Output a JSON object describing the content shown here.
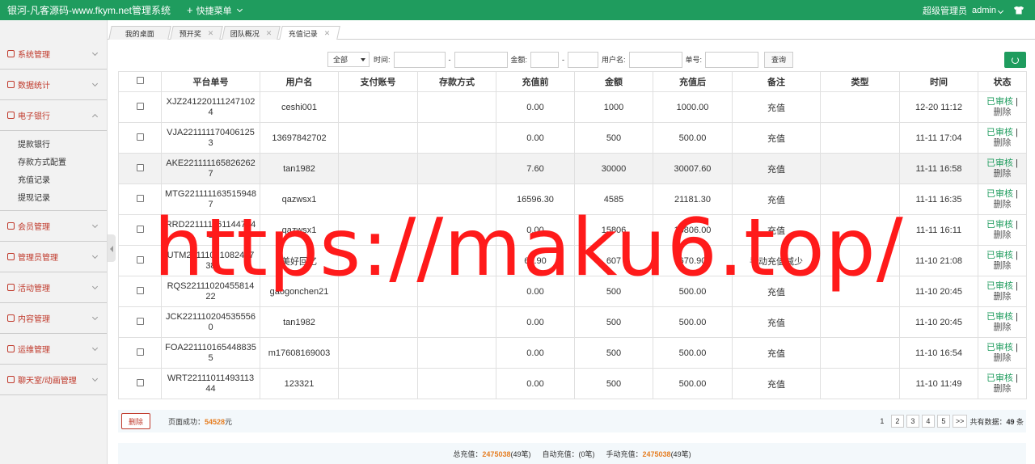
{
  "header": {
    "brand": "银河-凡客源码-www.fkym.net管理系统",
    "quick_menu": "快捷菜单",
    "role": "超级管理员",
    "user": "admin",
    "icons": [
      "plus-icon",
      "chevron-down-icon",
      "shirt-icon"
    ],
    "bg_color": "#1f9c5e"
  },
  "sidebar": {
    "items": [
      {
        "label": "系统管理",
        "expanded": false
      },
      {
        "label": "数据统计",
        "expanded": false
      },
      {
        "label": "电子银行",
        "expanded": true
      },
      {
        "label": "会员管理",
        "expanded": false
      },
      {
        "label": "管理员管理",
        "expanded": false
      },
      {
        "label": "活动管理",
        "expanded": false
      },
      {
        "label": "内容管理",
        "expanded": false
      },
      {
        "label": "运维管理",
        "expanded": false
      },
      {
        "label": "聊天室/动画管理",
        "expanded": false
      }
    ],
    "sub_items": [
      "提款银行",
      "存款方式配置",
      "充值记录",
      "提现记录"
    ]
  },
  "tabs": [
    {
      "label": "我的桌面",
      "closable": false
    },
    {
      "label": "预开奖",
      "closable": true
    },
    {
      "label": "团队概况",
      "closable": true
    },
    {
      "label": "充值记录",
      "closable": true,
      "active": true
    }
  ],
  "filters": {
    "select_value": "全部",
    "time_label": "时间:",
    "amount_label": "金额:",
    "username_label": "用户名:",
    "order_label": "单号:",
    "separator": "-",
    "query_button": "查询"
  },
  "table": {
    "headers": [
      "平台单号",
      "用户名",
      "支付账号",
      "存款方式",
      "充值前",
      "金额",
      "充值后",
      "备注",
      "类型",
      "时间",
      "状态"
    ],
    "rows": [
      {
        "order": "XJZ2412201112471024",
        "user": "ceshi001",
        "account": "",
        "method": "",
        "before": "0.00",
        "amount": "1000",
        "after": "1000.00",
        "note": "充值",
        "type": "",
        "time": "12-20 11:12",
        "status": "已审核",
        "action": "删除"
      },
      {
        "order": "VJA2211111704061253",
        "user": "13697842702",
        "account": "",
        "method": "",
        "before": "0.00",
        "amount": "500",
        "after": "500.00",
        "note": "充值",
        "type": "",
        "time": "11-11 17:04",
        "status": "已审核",
        "action": "删除"
      },
      {
        "order": "AKE2211111658262627",
        "user": "tan1982",
        "account": "",
        "method": "",
        "before": "7.60",
        "amount": "30000",
        "after": "30007.60",
        "note": "充值",
        "type": "",
        "time": "11-11 16:58",
        "status": "已审核",
        "action": "删除"
      },
      {
        "order": "MTG2211111635159487",
        "user": "qazwsx1",
        "account": "",
        "method": "",
        "before": "16596.30",
        "amount": "4585",
        "after": "21181.30",
        "note": "充值",
        "type": "",
        "time": "11-11 16:35",
        "status": "已审核",
        "action": "删除"
      },
      {
        "order": "RRD2211111611447541",
        "user": "qazwsx1",
        "account": "",
        "method": "",
        "before": "0.00",
        "amount": "15806",
        "after": "15806.00",
        "note": "充值",
        "type": "",
        "time": "11-11 16:11",
        "status": "已审核",
        "action": "删除"
      },
      {
        "order": "UTM2211102108241738",
        "user": "美好回忆",
        "account": "",
        "method": "",
        "before": "63.90",
        "amount": "607",
        "after": "670.90",
        "note": "手动充值减少",
        "type": "",
        "time": "11-10 21:08",
        "status": "已审核",
        "action": "删除"
      },
      {
        "order": "RQS2211102045581422",
        "user": "gaogonchen21",
        "account": "",
        "method": "",
        "before": "0.00",
        "amount": "500",
        "after": "500.00",
        "note": "充值",
        "type": "",
        "time": "11-10 20:45",
        "status": "已审核",
        "action": "删除"
      },
      {
        "order": "JCK2211102045355560",
        "user": "tan1982",
        "account": "",
        "method": "",
        "before": "0.00",
        "amount": "500",
        "after": "500.00",
        "note": "充值",
        "type": "",
        "time": "11-10 20:45",
        "status": "已审核",
        "action": "删除"
      },
      {
        "order": "FOA2211101654488355",
        "user": "m17608169003",
        "account": "",
        "method": "",
        "before": "0.00",
        "amount": "500",
        "after": "500.00",
        "note": "充值",
        "type": "",
        "time": "11-10 16:54",
        "status": "已审核",
        "action": "删除"
      },
      {
        "order": "WRT2211101149311344",
        "user": "123321",
        "account": "",
        "method": "",
        "before": "0.00",
        "amount": "500",
        "after": "500.00",
        "note": "充值",
        "type": "",
        "time": "11-10 11:49",
        "status": "已审核",
        "action": "删除"
      }
    ]
  },
  "footer": {
    "delete_button": "删除",
    "page_success_label": "页面成功：",
    "page_success_value": "54528",
    "page_success_unit": "元",
    "pages": [
      "1",
      "2",
      "3",
      "4",
      "5",
      ">>"
    ],
    "total_label": "共有数据：",
    "total_value": "49",
    "total_unit": "条",
    "sum_total_label": "总充值：",
    "sum_total_value": "2475038",
    "sum_total_count": "(49笔)",
    "auto_label": "自动充值：",
    "auto_value": "(0笔)",
    "manual_label": "手动充值：",
    "manual_value": "2475038",
    "manual_count": "(49笔)"
  },
  "watermark": "https://maku6.top/"
}
